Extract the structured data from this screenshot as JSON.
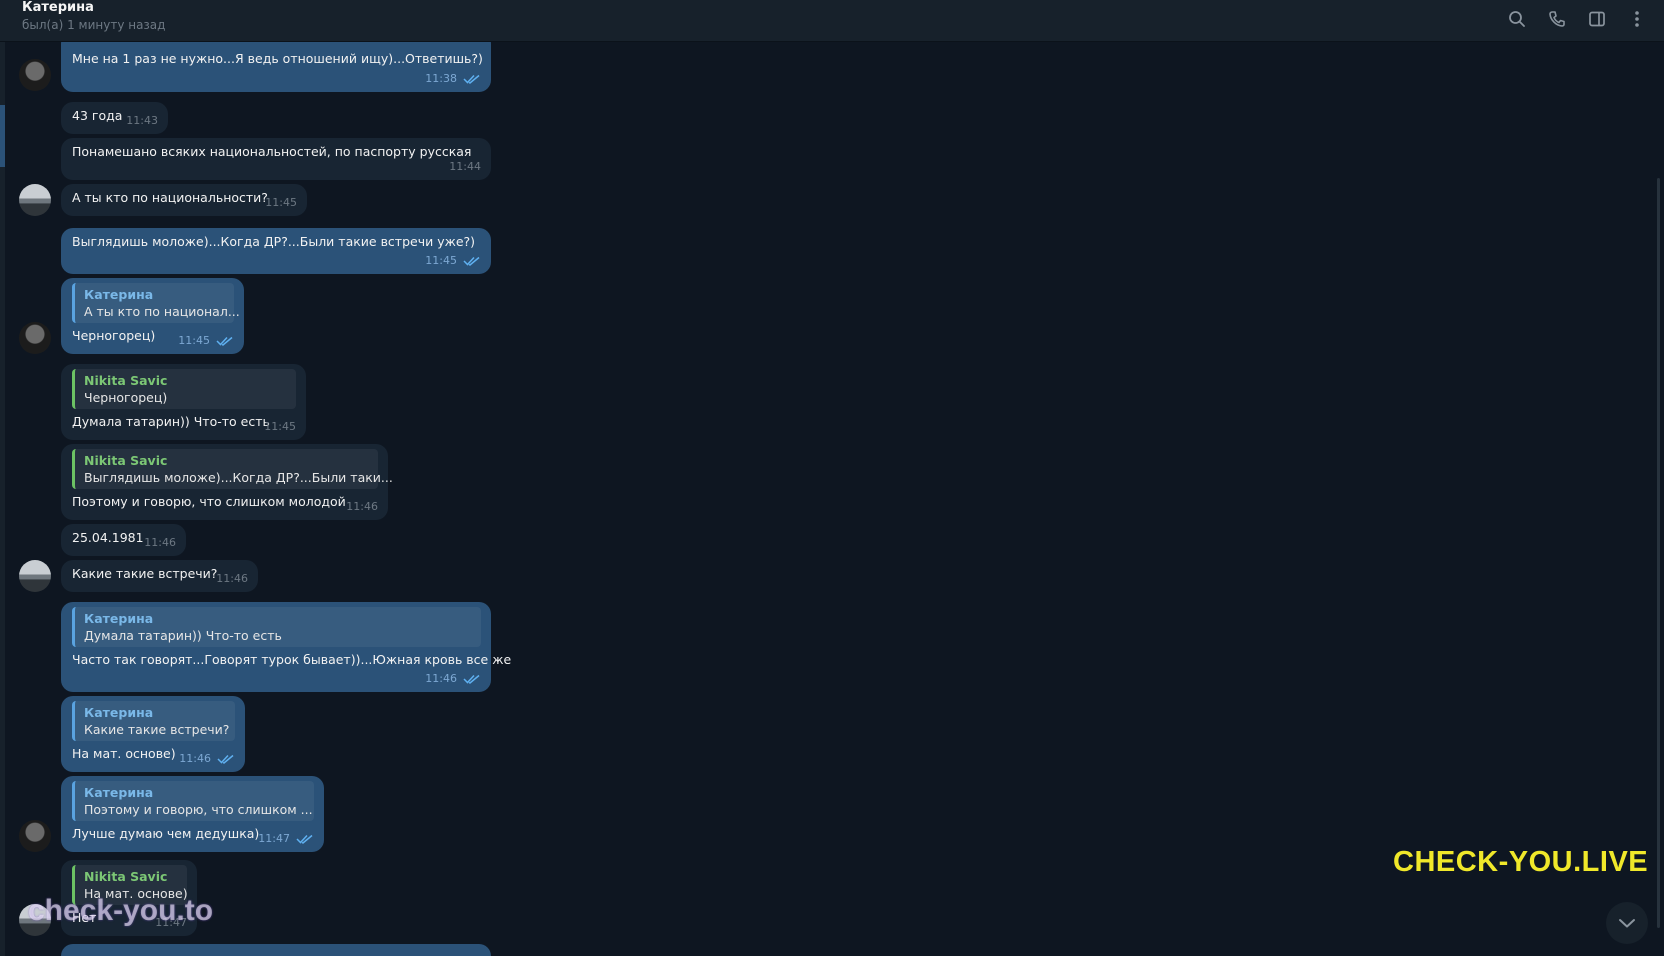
{
  "header": {
    "contact_name": "Катерина",
    "status": "был(а) 1 минуту назад",
    "icons": [
      "search-icon",
      "phone-icon",
      "sidebar-panel-icon",
      "more-vert-icon"
    ]
  },
  "messages": [
    {
      "text": "Мне на 1 раз не нужно...Я ведь отношений ищу)...Ответишь?)",
      "time": "11:38"
    },
    {
      "text": "43 года",
      "time": "11:43"
    },
    {
      "text": "Понамешано всяких национальностей, по паспорту русская",
      "time": "11:44"
    },
    {
      "text": "А ты кто по национальности?",
      "time": "11:45"
    },
    {
      "text": "Выглядишь моложе)...Когда ДР?...Были такие встречи уже?)",
      "time": "11:45"
    },
    {
      "quote_author": "Катерина",
      "quote_text": "А ты кто по национал...",
      "text": "Черногорец)",
      "time": "11:45"
    },
    {
      "quote_author": "Nikita Savic",
      "quote_text": "Черногорец)",
      "text": "Думала татарин)) Что-то есть",
      "time": "11:45"
    },
    {
      "quote_author": "Nikita Savic",
      "quote_text": "Выглядишь моложе)...Когда ДР?...Были таки...",
      "text": "Поэтому и говорю, что слишком молодой",
      "time": "11:46"
    },
    {
      "text": "25.04.1981",
      "time": "11:46"
    },
    {
      "text": "Какие такие встречи?",
      "time": "11:46"
    },
    {
      "quote_author": "Катерина",
      "quote_text": "Думала татарин)) Что-то есть",
      "text": "Часто так говорят...Говорят турок бывает))...Южная кровь все же",
      "time": "11:46"
    },
    {
      "quote_author": "Катерина",
      "quote_text": "Какие такие встречи?",
      "text": "На мат. основе)",
      "time": "11:46"
    },
    {
      "quote_author": "Катерина",
      "quote_text": "Поэтому и говорю, что слишком ...",
      "text": "Лучше думаю чем дедушка)",
      "time": "11:47"
    },
    {
      "quote_author": "Nikita Savic",
      "quote_text": "На мат. основе)",
      "text": "Нет",
      "time": "11:47"
    }
  ],
  "watermarks": {
    "right": "CHECK-YOU.LIVE",
    "left": "check-you.to"
  },
  "colors": {
    "background": "#0e1621",
    "header": "#17212b",
    "incoming_bubble": "#182533",
    "outgoing_bubble": "#2b5278",
    "accent_blue": "#7ab8e8",
    "accent_green": "#7cc775",
    "watermark_yellow": "#f0e82a"
  }
}
